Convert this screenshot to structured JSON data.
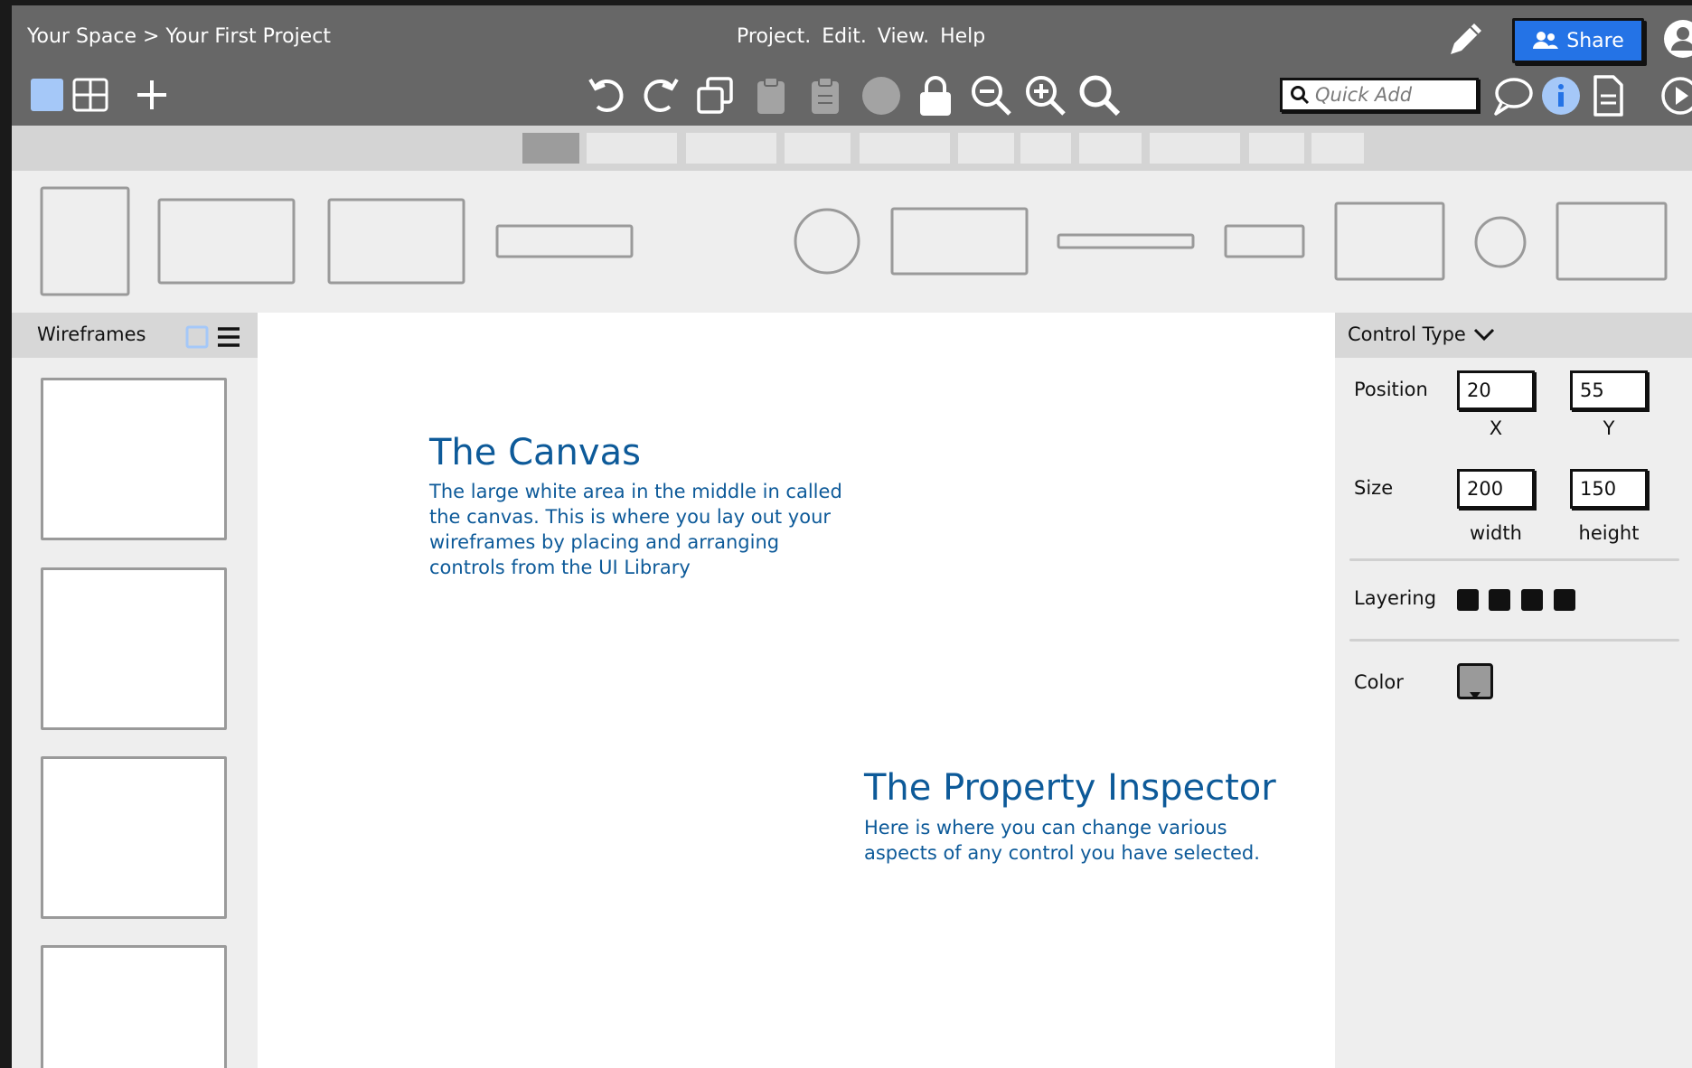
{
  "breadcrumb": "Your Space > Your First Project",
  "menu": [
    "Project.",
    "Edit.",
    "View.",
    "Help"
  ],
  "share": {
    "label": "Share",
    "color": "#2473e6"
  },
  "quick_add": {
    "placeholder": "Quick Add"
  },
  "icons": {
    "left_toolbar": [
      "single-view-icon",
      "grid-view-icon",
      "add-icon"
    ],
    "center_toolbar": [
      "undo-icon",
      "redo-icon",
      "duplicate-icon",
      "clipboard-icon",
      "paste-icon",
      "circle-icon",
      "lock-icon",
      "zoom-out-icon",
      "zoom-in-icon",
      "search-icon"
    ],
    "right_toolbar": [
      "pencil-icon",
      "users-icon",
      "account-icon",
      "comment-icon",
      "info-icon",
      "document-icon",
      "play-icon"
    ]
  },
  "left_panel": {
    "title": "Wireframes"
  },
  "canvas": {
    "canvas_note": {
      "title": "The Canvas",
      "body": "The large white area in the middle in called the canvas. This is where you lay out your wireframes by placing and arranging controls from the UI Library"
    },
    "inspector_note": {
      "title": "The Property Inspector",
      "body": "Here is where you can change various aspects of any control you have selected."
    }
  },
  "inspector": {
    "title": "Control Type",
    "position": {
      "label": "Position",
      "x": "20",
      "y": "55",
      "x_label": "X",
      "y_label": "Y"
    },
    "size": {
      "label": "Size",
      "width": "200",
      "height": "150",
      "width_label": "width",
      "height_label": "height"
    },
    "layering": {
      "label": "Layering"
    },
    "color": {
      "label": "Color",
      "value": "#9a9a9a"
    }
  },
  "colors": {
    "toolbar": "#676767",
    "accent_blue": "#2473e6",
    "annotation": "#0d5a99",
    "selected": "#a5c8f8"
  }
}
